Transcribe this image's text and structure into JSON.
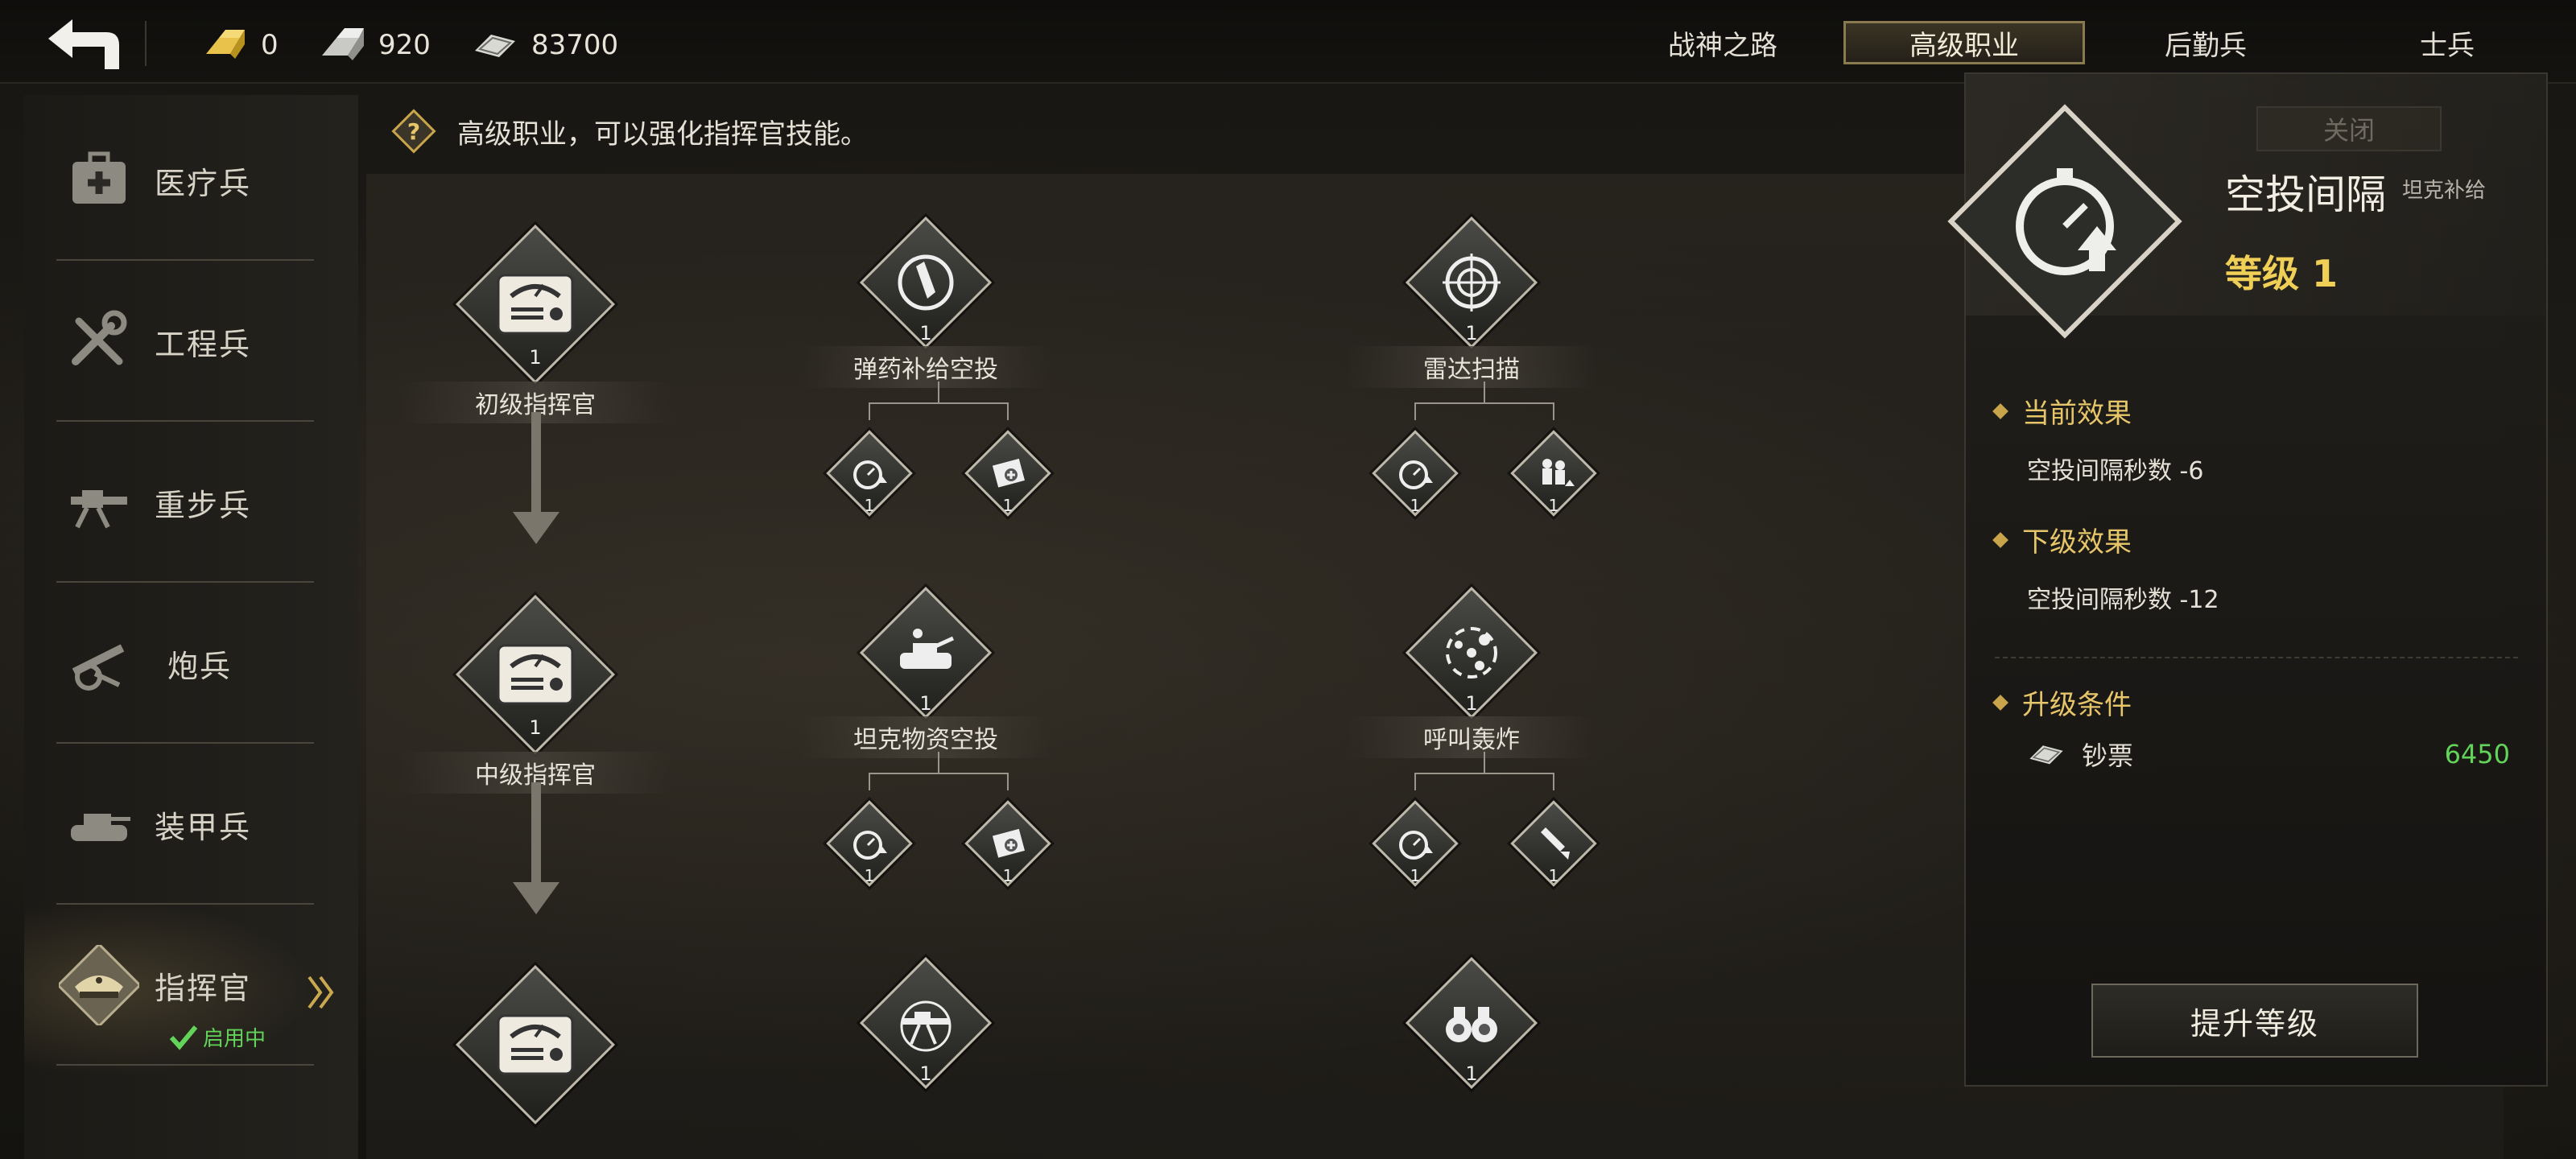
{
  "resources": {
    "gold": "0",
    "silver": "920",
    "cash": "83700"
  },
  "tabs": [
    "战神之路",
    "高级职业",
    "后勤兵",
    "士兵"
  ],
  "active_tab_index": 1,
  "sidebar": {
    "items": [
      {
        "label": "医疗兵",
        "icon": "medkit-icon"
      },
      {
        "label": "工程兵",
        "icon": "tools-icon"
      },
      {
        "label": "重步兵",
        "icon": "heavy-gun-icon"
      },
      {
        "label": "炮兵",
        "icon": "artillery-icon"
      },
      {
        "label": "装甲兵",
        "icon": "tank-icon"
      },
      {
        "label": "指挥官",
        "icon": "officer-cap-icon"
      }
    ],
    "enabled_text": "启用中"
  },
  "hint": "高级职业，可以强化指挥官技能。",
  "tree": {
    "tiers": [
      "初级指挥官",
      "中级指挥官",
      ""
    ],
    "skills": [
      {
        "name": "弹药补给空投",
        "level": "1",
        "icon": "ammo-drop-icon"
      },
      {
        "name": "雷达扫描",
        "level": "1",
        "icon": "radar-icon"
      },
      {
        "name": "坦克物资空投",
        "level": "1",
        "icon": "tank-drop-icon"
      },
      {
        "name": "呼叫轰炸",
        "level": "1",
        "icon": "bombard-icon"
      },
      {
        "name": "",
        "level": "1",
        "icon": "machine-gun-icon"
      },
      {
        "name": "",
        "level": "1",
        "icon": "binoculars-icon"
      }
    ],
    "sub_levels": "1",
    "tier_level": "1"
  },
  "detail": {
    "close_label": "关闭",
    "title": "空投间隔",
    "subtitle": "坦克补给",
    "level": "等级 1",
    "current_effect_label": "当前效果",
    "current_effect_value": "空投间隔秒数 -6",
    "next_effect_label": "下级效果",
    "next_effect_value": "空投间隔秒数 -12",
    "upgrade_condition_label": "升级条件",
    "cost_name": "钞票",
    "cost_value": "6450",
    "upgrade_button": "提升等级"
  },
  "colors": {
    "accent_gold": "#f0cf57",
    "green": "#63d45a"
  }
}
